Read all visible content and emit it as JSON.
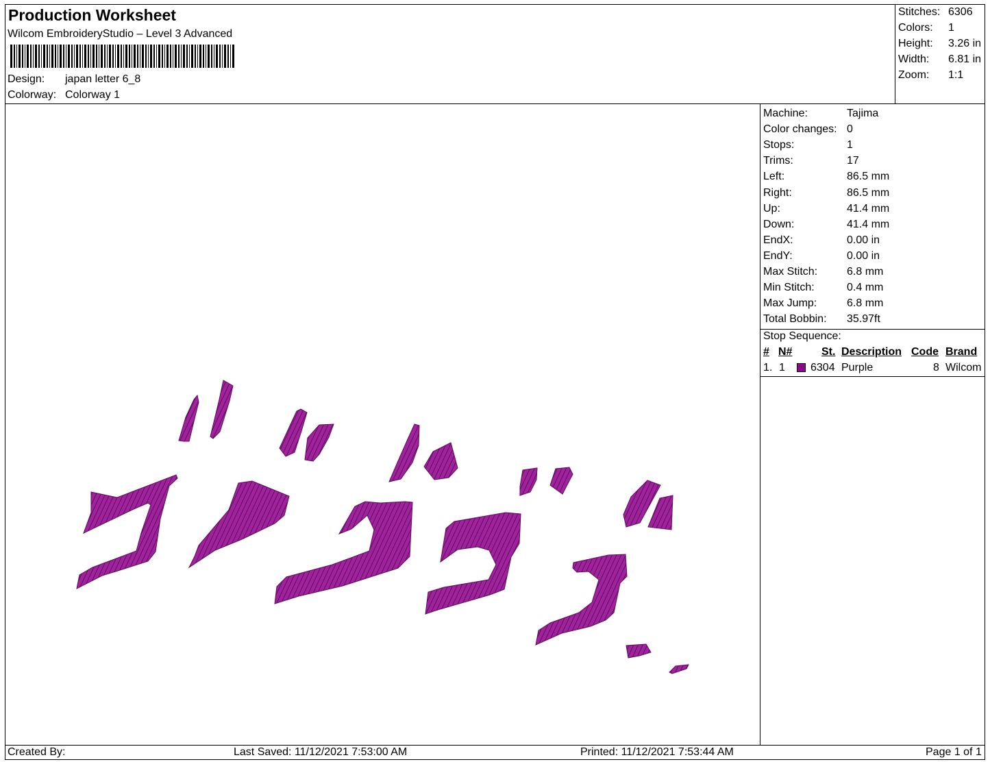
{
  "header": {
    "title": "Production Worksheet",
    "subtitle": "Wilcom EmbroideryStudio – Level 3 Advanced",
    "design_label": "Design:",
    "design_value": "japan letter 6_8",
    "colorway_label": "Colorway:",
    "colorway_value": "Colorway 1"
  },
  "summary": {
    "stitches_label": "Stitches:",
    "stitches_value": "6306",
    "colors_label": "Colors:",
    "colors_value": "1",
    "height_label": "Height:",
    "height_value": "3.26 in",
    "width_label": "Width:",
    "width_value": "6.81 in",
    "zoom_label": "Zoom:",
    "zoom_value": "1:1"
  },
  "info": {
    "rows": [
      {
        "label": "Machine:",
        "value": "Tajima"
      },
      {
        "label": "Color changes:",
        "value": "0"
      },
      {
        "label": "Stops:",
        "value": "1"
      },
      {
        "label": "Trims:",
        "value": "17"
      },
      {
        "label": "Left:",
        "value": "86.5 mm"
      },
      {
        "label": "Right:",
        "value": "86.5 mm"
      },
      {
        "label": "Up:",
        "value": "41.4 mm"
      },
      {
        "label": "Down:",
        "value": "41.4 mm"
      },
      {
        "label": "EndX:",
        "value": "0.00 in"
      },
      {
        "label": "EndY:",
        "value": "0.00 in"
      },
      {
        "label": "Max Stitch:",
        "value": "6.8 mm"
      },
      {
        "label": "Min Stitch:",
        "value": "0.4 mm"
      },
      {
        "label": "Max Jump:",
        "value": "6.8 mm"
      },
      {
        "label": "Total Bobbin:",
        "value": "35.97ft"
      }
    ]
  },
  "stop_sequence": {
    "heading": "Stop Sequence:",
    "columns": {
      "num": "#",
      "n": "N#",
      "st": "St.",
      "desc": "Description",
      "code": "Code",
      "brand": "Brand"
    },
    "rows": [
      {
        "num": "1.",
        "n": "1",
        "st": "6304",
        "desc": "Purple",
        "code": "8",
        "brand": "Wilcom",
        "color": "#8b0a8c"
      }
    ]
  },
  "design": {
    "thread_color": "#a0239d",
    "stitch_color": "#5e0d5c"
  },
  "footer": {
    "created_by": "Created By:",
    "last_saved": "Last Saved: 11/12/2021 7:53:00 AM",
    "printed": "Printed: 11/12/2021 7:53:44 AM",
    "page": "Page 1 of 1"
  }
}
